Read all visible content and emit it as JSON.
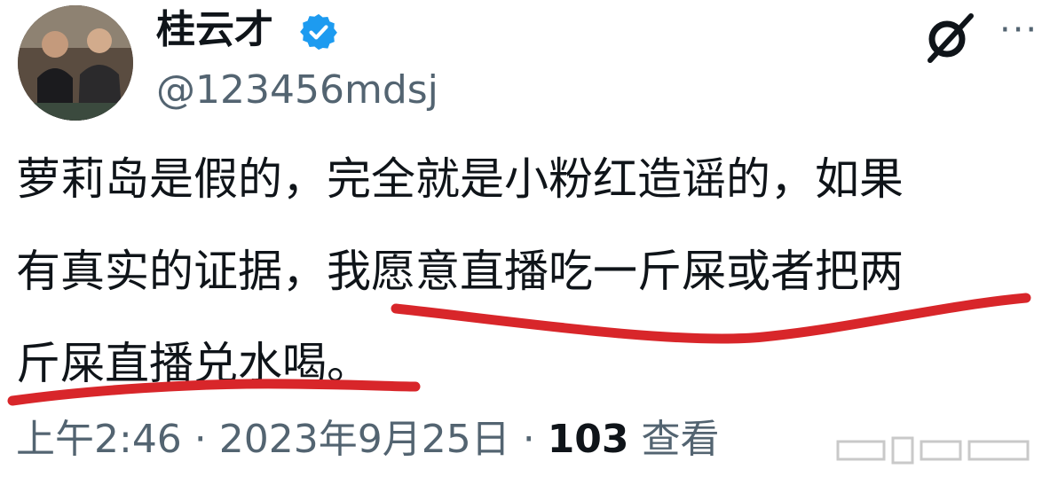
{
  "tweet": {
    "author_name": "桂云才",
    "handle": "@123456mdsj",
    "text_lines": [
      "萝莉岛是假的，完全就是小粉红造谣的，如果",
      "有真实的证据，我愿意直播吃一斤屎或者把两",
      "斤屎直播兑水喝。"
    ],
    "time": "上午2:46 · 2023年9月25日 · ",
    "views_count": "103",
    "views_label": " 查看"
  },
  "icons": {
    "verified": "verified-badge-icon",
    "logo": "twitter-x-logo-icon",
    "more": "more-options-icon"
  },
  "colors": {
    "verified_blue": "#1d9bf0",
    "underline_red": "#d8262a",
    "secondary_text": "#536471"
  }
}
